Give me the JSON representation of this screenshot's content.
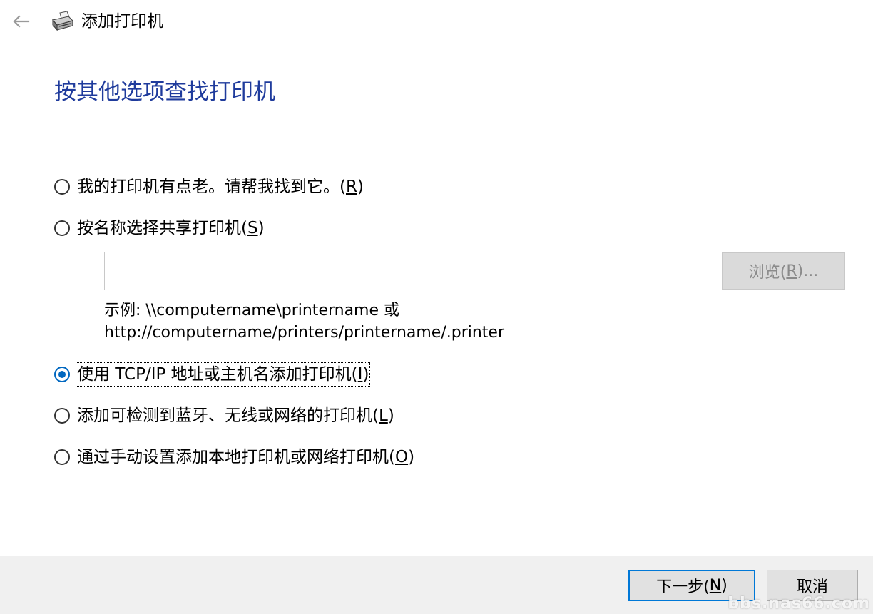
{
  "window": {
    "title": "添加打印机"
  },
  "heading": "按其他选项查找打印机",
  "options": [
    {
      "label": "我的打印机有点老。请帮我找到它。(",
      "key": "R",
      "suffix": ")",
      "checked": false
    },
    {
      "label": "按名称选择共享打印机(",
      "key": "S",
      "suffix": ")",
      "checked": false
    },
    {
      "label": "使用 TCP/IP 地址或主机名添加打印机(",
      "key": "I",
      "suffix": ")",
      "checked": true
    },
    {
      "label": "添加可检测到蓝牙、无线或网络的打印机(",
      "key": "L",
      "suffix": ")",
      "checked": false
    },
    {
      "label": "通过手动设置添加本地打印机或网络打印机(",
      "key": "O",
      "suffix": ")",
      "checked": false
    }
  ],
  "share": {
    "value": "",
    "browse_label": "浏览(",
    "browse_key": "R",
    "browse_suffix": ")...",
    "example_line1": "示例: \\\\computername\\printername 或",
    "example_line2": "http://computername/printers/printername/.printer"
  },
  "footer": {
    "next_label": "下一步(",
    "next_key": "N",
    "next_suffix": ")",
    "cancel_label": "取消"
  },
  "watermark": "bbs.nas66.com",
  "colors": {
    "heading": "#1f3b9c",
    "accent": "#0067c0",
    "footer_bg": "#f0f0f0"
  }
}
